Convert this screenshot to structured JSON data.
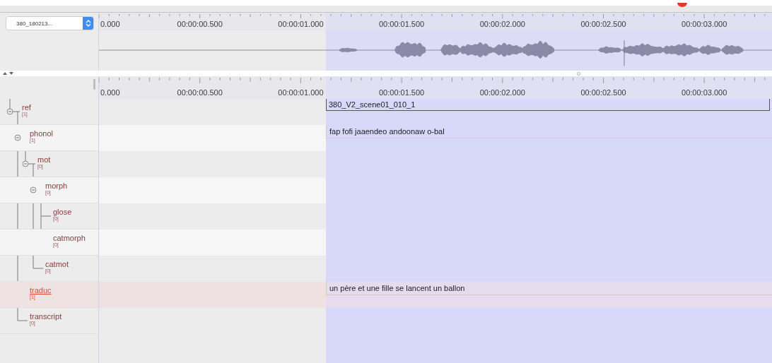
{
  "media_select": {
    "value": "380_180213..."
  },
  "top_ruler": {
    "labels": [
      "0.000",
      "00:00:00.500",
      "00:00:01.000",
      "00:00:01.500",
      "00:00:02.000",
      "00:00:02.500",
      "00:00:03.000"
    ]
  },
  "bottom_ruler": {
    "labels": [
      "0.000",
      "00:00:00.500",
      "00:00:01.000",
      "00:00:01.500",
      "00:00:02.000",
      "00:00:02.500",
      "00:00:03.000"
    ]
  },
  "tiers": [
    {
      "name": "ref",
      "count": "[1]",
      "selected": false,
      "annotation": {
        "kind": "segment",
        "text": "380_V2_scene01_010_1"
      },
      "children": [
        {
          "name": "phonol",
          "count": "[1]",
          "selected": false,
          "annotation": {
            "kind": "interval",
            "text": "fap fofi jaaendeo andoonaw o-bal"
          },
          "children": [
            {
              "name": "mot",
              "count": "[0]",
              "selected": false,
              "children": [
                {
                  "name": "morph",
                  "count": "[0]",
                  "selected": false,
                  "children": [
                    {
                      "name": "glose",
                      "count": "[0]",
                      "selected": false
                    },
                    {
                      "name": "catmorph",
                      "count": "[0]",
                      "selected": false
                    }
                  ]
                },
                {
                  "name": "catmot",
                  "count": "[0]",
                  "selected": false
                }
              ]
            }
          ]
        },
        {
          "name": "traduc",
          "count": "[1]",
          "selected": true,
          "annotation": {
            "kind": "interval",
            "text": "un père et une fille se lancent un ballon"
          }
        },
        {
          "name": "transcript",
          "count": "[0]",
          "selected": false
        }
      ]
    }
  ]
}
